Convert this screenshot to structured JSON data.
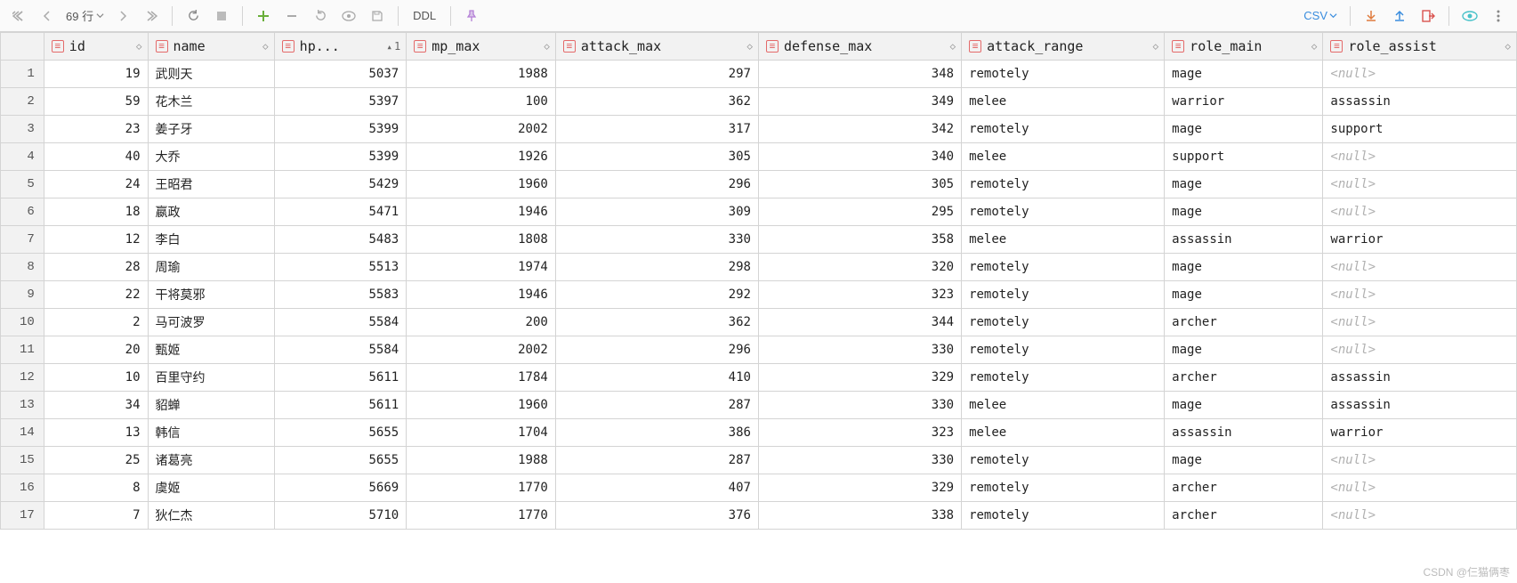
{
  "toolbar": {
    "rowcount_label": "69 行",
    "ddl_label": "DDL",
    "csv_label": "CSV"
  },
  "columns": [
    {
      "key": "id",
      "label": "id",
      "sort": ""
    },
    {
      "key": "name",
      "label": "name",
      "sort": ""
    },
    {
      "key": "hp",
      "label": "hp...",
      "sort": "^ 1"
    },
    {
      "key": "mp",
      "label": "mp_max",
      "sort": ""
    },
    {
      "key": "atk",
      "label": "attack_max",
      "sort": ""
    },
    {
      "key": "def",
      "label": "defense_max",
      "sort": ""
    },
    {
      "key": "rng",
      "label": "attack_range",
      "sort": ""
    },
    {
      "key": "rmain",
      "label": "role_main",
      "sort": ""
    },
    {
      "key": "rasst",
      "label": "role_assist",
      "sort": ""
    }
  ],
  "rows": [
    {
      "id": 19,
      "name": "武则天",
      "hp": 5037,
      "mp": 1988,
      "atk": 297,
      "def": 348,
      "rng": "remotely",
      "rmain": "mage",
      "rasst": null
    },
    {
      "id": 59,
      "name": "花木兰",
      "hp": 5397,
      "mp": 100,
      "atk": 362,
      "def": 349,
      "rng": "melee",
      "rmain": "warrior",
      "rasst": "assassin"
    },
    {
      "id": 23,
      "name": "姜子牙",
      "hp": 5399,
      "mp": 2002,
      "atk": 317,
      "def": 342,
      "rng": "remotely",
      "rmain": "mage",
      "rasst": "support"
    },
    {
      "id": 40,
      "name": "大乔",
      "hp": 5399,
      "mp": 1926,
      "atk": 305,
      "def": 340,
      "rng": "melee",
      "rmain": "support",
      "rasst": null
    },
    {
      "id": 24,
      "name": "王昭君",
      "hp": 5429,
      "mp": 1960,
      "atk": 296,
      "def": 305,
      "rng": "remotely",
      "rmain": "mage",
      "rasst": null
    },
    {
      "id": 18,
      "name": "嬴政",
      "hp": 5471,
      "mp": 1946,
      "atk": 309,
      "def": 295,
      "rng": "remotely",
      "rmain": "mage",
      "rasst": null
    },
    {
      "id": 12,
      "name": "李白",
      "hp": 5483,
      "mp": 1808,
      "atk": 330,
      "def": 358,
      "rng": "melee",
      "rmain": "assassin",
      "rasst": "warrior"
    },
    {
      "id": 28,
      "name": "周瑜",
      "hp": 5513,
      "mp": 1974,
      "atk": 298,
      "def": 320,
      "rng": "remotely",
      "rmain": "mage",
      "rasst": null
    },
    {
      "id": 22,
      "name": "干将莫邪",
      "hp": 5583,
      "mp": 1946,
      "atk": 292,
      "def": 323,
      "rng": "remotely",
      "rmain": "mage",
      "rasst": null
    },
    {
      "id": 2,
      "name": "马可波罗",
      "hp": 5584,
      "mp": 200,
      "atk": 362,
      "def": 344,
      "rng": "remotely",
      "rmain": "archer",
      "rasst": null
    },
    {
      "id": 20,
      "name": "甄姬",
      "hp": 5584,
      "mp": 2002,
      "atk": 296,
      "def": 330,
      "rng": "remotely",
      "rmain": "mage",
      "rasst": null
    },
    {
      "id": 10,
      "name": "百里守约",
      "hp": 5611,
      "mp": 1784,
      "atk": 410,
      "def": 329,
      "rng": "remotely",
      "rmain": "archer",
      "rasst": "assassin"
    },
    {
      "id": 34,
      "name": "貂蝉",
      "hp": 5611,
      "mp": 1960,
      "atk": 287,
      "def": 330,
      "rng": "melee",
      "rmain": "mage",
      "rasst": "assassin"
    },
    {
      "id": 13,
      "name": "韩信",
      "hp": 5655,
      "mp": 1704,
      "atk": 386,
      "def": 323,
      "rng": "melee",
      "rmain": "assassin",
      "rasst": "warrior"
    },
    {
      "id": 25,
      "name": "诸葛亮",
      "hp": 5655,
      "mp": 1988,
      "atk": 287,
      "def": 330,
      "rng": "remotely",
      "rmain": "mage",
      "rasst": null
    },
    {
      "id": 8,
      "name": "虞姬",
      "hp": 5669,
      "mp": 1770,
      "atk": 407,
      "def": 329,
      "rng": "remotely",
      "rmain": "archer",
      "rasst": null
    },
    {
      "id": 7,
      "name": "狄仁杰",
      "hp": 5710,
      "mp": 1770,
      "atk": 376,
      "def": 338,
      "rng": "remotely",
      "rmain": "archer",
      "rasst": null
    }
  ],
  "null_label": "<null>",
  "watermark": "CSDN @仨猫俩枣"
}
